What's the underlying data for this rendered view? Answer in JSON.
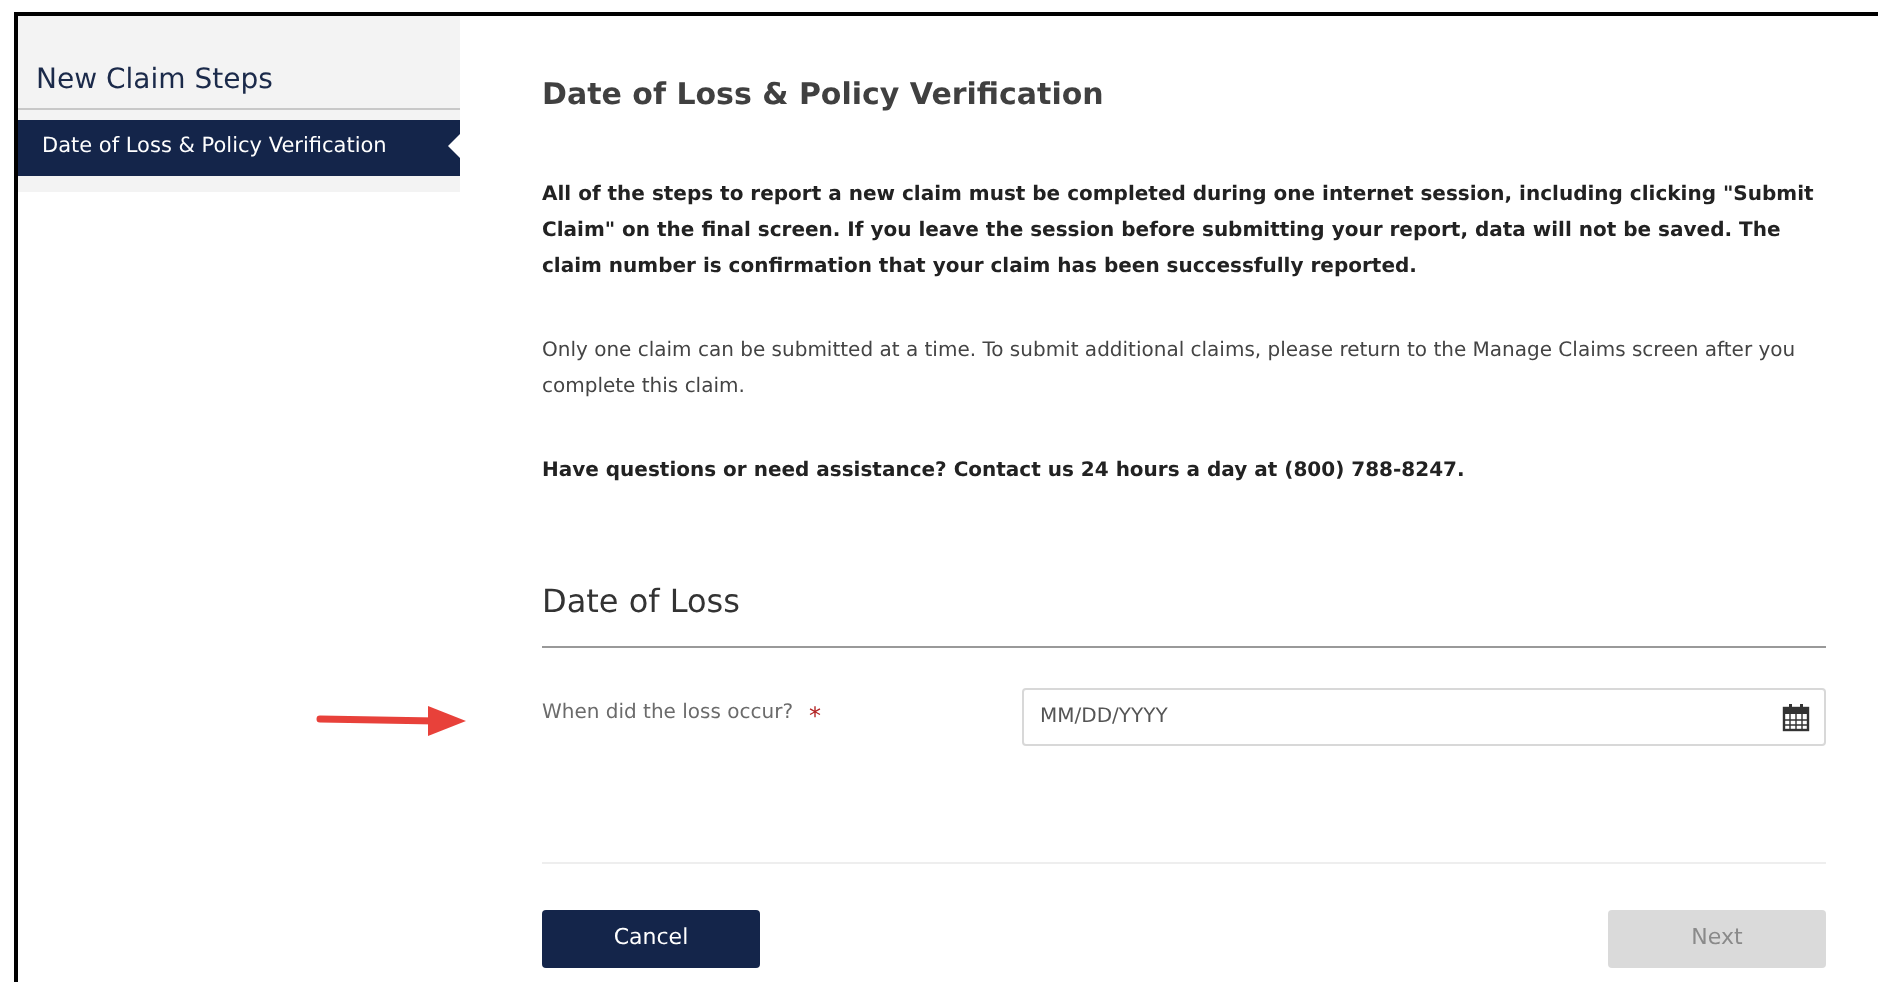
{
  "sidebar": {
    "title": "New Claim Steps",
    "items": [
      {
        "label": "Date of Loss & Policy Verification",
        "selected": true
      }
    ]
  },
  "page": {
    "title": "Date of Loss & Policy Verification",
    "paragraphs": [
      {
        "kind": "bold",
        "text": "All of the steps to report a new claim must be completed during one internet session, including clicking \"Submit Claim\" on the final screen. If you leave the session before submitting your report, data will not be saved. The claim number is confirmation that your claim has been successfully reported."
      },
      {
        "kind": "normal",
        "text": "Only one claim can be submitted at a time. To submit additional claims, please return to the Manage Claims screen after you complete this claim."
      },
      {
        "kind": "bold",
        "text": "Have questions or need assistance? Contact us 24 hours a day at (800) 788-8247."
      }
    ]
  },
  "section": {
    "title": "Date of Loss",
    "field": {
      "label": "When did the loss occur?",
      "required_mark": "*",
      "placeholder": "MM/DD/YYYY"
    }
  },
  "buttons": [
    {
      "label": "Cancel",
      "disabled": false
    },
    {
      "label": "Next",
      "disabled": true
    }
  ]
}
